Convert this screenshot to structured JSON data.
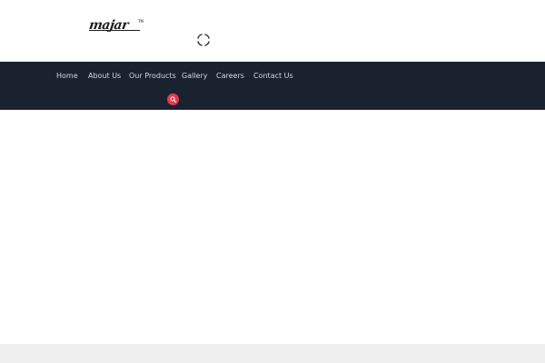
{
  "header": {
    "logo_text": "majar",
    "logo_tm": "TM",
    "expand_icon": "expand-icon"
  },
  "nav": {
    "items": [
      {
        "label": "Home"
      },
      {
        "label": "About Us"
      },
      {
        "label": "Our Products"
      },
      {
        "label": "Gallery"
      },
      {
        "label": "Careers"
      },
      {
        "label": "Contact Us"
      }
    ],
    "search_icon": "search-icon"
  },
  "colors": {
    "nav_background": "#1a2230",
    "nav_text": "#d4d8de",
    "search_accent": "#e53b4f",
    "footer_strip": "#f0f0f0"
  }
}
